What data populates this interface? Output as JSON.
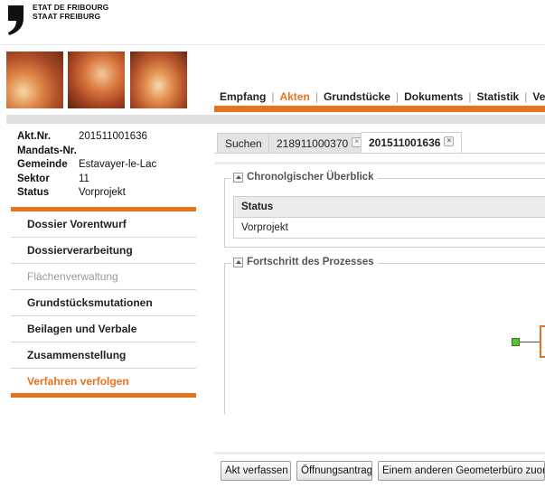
{
  "header": {
    "logo_line1": "ETAT DE FRIBOURG",
    "logo_line2": "STAAT FREIBURG"
  },
  "topnav": {
    "items": [
      "Empfang",
      "Akten",
      "Grundstücke",
      "Dokuments",
      "Statistik",
      "Ver"
    ],
    "active": "Akten"
  },
  "info": {
    "rows": [
      {
        "label": "Akt.Nr.",
        "value": "201511001636"
      },
      {
        "label": "Mandats-Nr.",
        "value": ""
      },
      {
        "label": "Gemeinde",
        "value": "Estavayer-le-Lac"
      },
      {
        "label": "Sektor",
        "value": "11"
      },
      {
        "label": "Status",
        "value": "Vorprojekt"
      }
    ]
  },
  "menu": {
    "items": [
      {
        "label": "Dossier Vorentwurf",
        "state": "normal"
      },
      {
        "label": "Dossierverarbeitung",
        "state": "normal"
      },
      {
        "label": "Flächenverwaltung",
        "state": "disabled"
      },
      {
        "label": "Grundstücksmutationen",
        "state": "normal"
      },
      {
        "label": "Beilagen und Verbale",
        "state": "normal"
      },
      {
        "label": "Zusammenstellung",
        "state": "normal"
      },
      {
        "label": "Verfahren verfolgen",
        "state": "active"
      }
    ]
  },
  "tabs": [
    {
      "label": "Suchen",
      "closable": false,
      "active": false
    },
    {
      "label": "218911000370",
      "closable": true,
      "active": false
    },
    {
      "label": "201511001636",
      "closable": true,
      "active": true
    }
  ],
  "chrono": {
    "legend": "Chronolgischer Überblick",
    "column": "Status",
    "rows": [
      "Vorprojekt"
    ]
  },
  "progress": {
    "legend": "Fortschritt des Prozesses"
  },
  "buttons": {
    "akt_verfassen": "Akt verfassen",
    "oeffnungsantrag": "Öffnungsantrag",
    "anderes_buero": "Einem anderen Geometerbüro zuordnen"
  },
  "colors": {
    "accent": "#e8721c",
    "node": "#5bbf3a"
  },
  "icons": {
    "tab_close": "close-icon",
    "collapse": "chevron-up-icon",
    "logo": "comma-logo-icon"
  }
}
